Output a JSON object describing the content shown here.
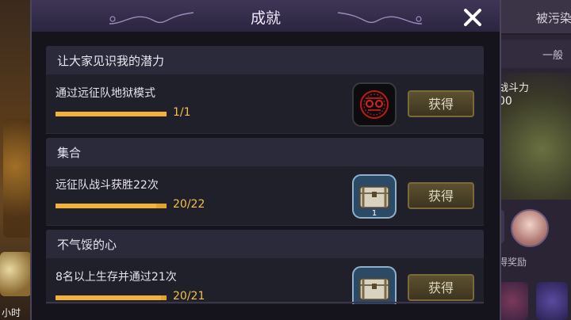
{
  "modal": {
    "title": "成就"
  },
  "achievements": [
    {
      "group_title": "让大家见识我的潜力",
      "description": "通过远征队地狱模式",
      "progress_text": "1/1",
      "progress": 1.0,
      "reward_icon": "hell-mode-emblem-icon",
      "reward_count": "",
      "button_label": "获得"
    },
    {
      "group_title": "集合",
      "description": "远征队战斗获胜22次",
      "progress_text": "20/22",
      "progress": 0.909,
      "reward_icon": "treasure-chest-icon",
      "reward_count": "1",
      "button_label": "获得"
    },
    {
      "group_title": "不气馁的心",
      "description": "8名以上生存并通过21次",
      "progress_text": "20/21",
      "progress": 0.952,
      "reward_icon": "treasure-chest-icon",
      "reward_count": "",
      "button_label": "获得"
    }
  ],
  "background": {
    "top_right_tab": "被污染",
    "second_tab": "一般",
    "combat_power_label": "战斗力",
    "combat_power_value": "00",
    "reward_label": "得奖励",
    "bottom_left_text": "小时"
  },
  "colors": {
    "progress_bar": "#f3b33a",
    "progress_text": "#f3c04a",
    "button_border": "#7a6a38"
  }
}
